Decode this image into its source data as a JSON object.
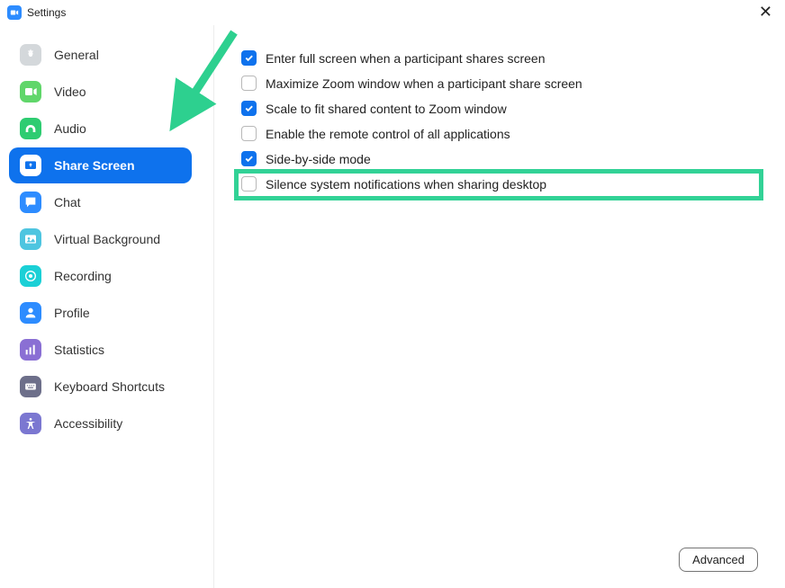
{
  "window": {
    "title": "Settings"
  },
  "sidebar": {
    "items": [
      {
        "label": "General",
        "icon": "general",
        "selected": false
      },
      {
        "label": "Video",
        "icon": "video",
        "selected": false
      },
      {
        "label": "Audio",
        "icon": "audio",
        "selected": false
      },
      {
        "label": "Share Screen",
        "icon": "share",
        "selected": true
      },
      {
        "label": "Chat",
        "icon": "chat",
        "selected": false
      },
      {
        "label": "Virtual Background",
        "icon": "vbg",
        "selected": false
      },
      {
        "label": "Recording",
        "icon": "recording",
        "selected": false
      },
      {
        "label": "Profile",
        "icon": "profile",
        "selected": false
      },
      {
        "label": "Statistics",
        "icon": "stats",
        "selected": false
      },
      {
        "label": "Keyboard Shortcuts",
        "icon": "keyboard",
        "selected": false
      },
      {
        "label": "Accessibility",
        "icon": "accessibility",
        "selected": false
      }
    ]
  },
  "share_screen_options": [
    {
      "label": "Enter full screen when a participant shares screen",
      "checked": true,
      "highlighted": false
    },
    {
      "label": "Maximize Zoom window when a participant share screen",
      "checked": false,
      "highlighted": false
    },
    {
      "label": "Scale to fit shared content to Zoom window",
      "checked": true,
      "highlighted": false
    },
    {
      "label": "Enable the remote control of all applications",
      "checked": false,
      "highlighted": false
    },
    {
      "label": "Side-by-side mode",
      "checked": true,
      "highlighted": false
    },
    {
      "label": "Silence system notifications when sharing desktop",
      "checked": false,
      "highlighted": true
    }
  ],
  "buttons": {
    "advanced": "Advanced"
  },
  "icon_colors": {
    "general": "#d4d8db",
    "video": "#60d66a",
    "audio": "#2ecc71",
    "share": "#0e72ed",
    "chat": "#2d8cff",
    "vbg": "#4ec5e0",
    "recording": "#1bd0d6",
    "profile": "#2d8cff",
    "stats": "#8a6fd4",
    "keyboard": "#6d6f8a",
    "accessibility": "#7b77d1"
  }
}
